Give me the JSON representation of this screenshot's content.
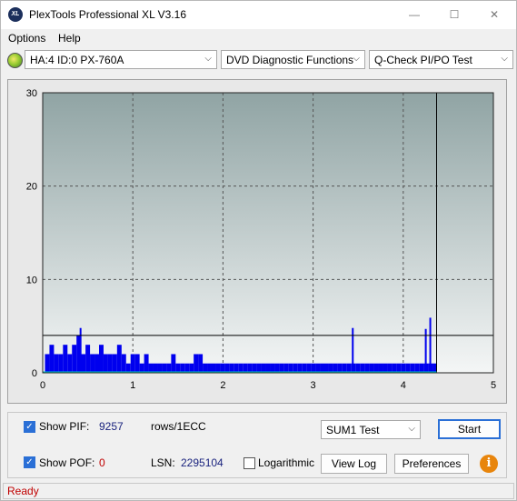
{
  "window": {
    "title": "PlexTools Professional XL V3.16",
    "app_icon_text": "XL",
    "minimize_glyph": "—",
    "maximize_glyph": "☐",
    "close_glyph": "✕"
  },
  "menu": {
    "options": "Options",
    "help": "Help"
  },
  "toolbar": {
    "drive": "HA:4 ID:0  PX-760A",
    "function": "DVD Diagnostic Functions",
    "test": "Q-Check PI/PO Test",
    "arrow_glyph": "⌵"
  },
  "chart_data": {
    "type": "bar",
    "title": "",
    "xlabel": "",
    "ylabel": "",
    "xlim": [
      0,
      5
    ],
    "ylim": [
      0,
      30
    ],
    "x_ticks": [
      0,
      1,
      2,
      3,
      4,
      5
    ],
    "y_ticks": [
      0,
      10,
      20,
      30
    ],
    "grid": true,
    "threshold_line": 4,
    "end_marker_x": 4.37,
    "colors": {
      "bars": "#0000ee",
      "plot_bg_top": "#90a4a4",
      "plot_bg_bottom": "#f4f6f6",
      "threshold": "#000000",
      "baseline_po": "#00c8c8"
    },
    "series": [
      {
        "x": [
          0.05,
          0.1,
          0.15,
          0.2,
          0.25,
          0.3,
          0.35,
          0.4,
          0.45,
          0.5,
          0.55,
          0.6,
          0.65,
          0.7,
          0.75,
          0.8,
          0.85,
          0.9,
          0.95,
          1.0,
          1.05,
          1.1,
          1.15,
          1.2,
          1.25,
          1.3,
          1.35,
          1.4,
          1.45,
          1.5,
          1.55,
          1.6,
          1.65,
          1.7,
          1.75,
          1.8,
          1.85,
          1.9,
          1.95,
          2.0,
          2.05,
          2.1,
          2.15,
          2.2,
          2.25,
          2.3,
          2.35,
          2.4,
          2.45,
          2.5,
          2.55,
          2.6,
          2.65,
          2.7,
          2.75,
          2.8,
          2.85,
          2.9,
          2.95,
          3.0,
          3.05,
          3.1,
          3.15,
          3.2,
          3.25,
          3.3,
          3.35,
          3.4,
          3.45,
          3.5,
          3.55,
          3.6,
          3.65,
          3.7,
          3.75,
          3.8,
          3.85,
          3.9,
          3.95,
          4.0,
          4.05,
          4.1,
          4.15,
          4.2,
          4.25,
          4.3,
          4.35
        ],
        "values": [
          2,
          3,
          2,
          2,
          3,
          2,
          3,
          4,
          2,
          3,
          2,
          2,
          3,
          2,
          2,
          2,
          3,
          2,
          1,
          2,
          2,
          1,
          2,
          1,
          1,
          1,
          1,
          1,
          2,
          1,
          1,
          1,
          1,
          2,
          2,
          1,
          1,
          1,
          1,
          1,
          1,
          1,
          1,
          1,
          1,
          1,
          1,
          1,
          1,
          1,
          1,
          1,
          1,
          1,
          1,
          1,
          1,
          1,
          1,
          1,
          1,
          1,
          1,
          1,
          1,
          1,
          1,
          1,
          1,
          1,
          1,
          1,
          1,
          1,
          1,
          1,
          1,
          1,
          1,
          1,
          1,
          1,
          1,
          1,
          1,
          1,
          1
        ]
      }
    ],
    "peaks": [
      {
        "x": 0.42,
        "y": 4.8
      },
      {
        "x": 3.44,
        "y": 4.8
      },
      {
        "x": 4.3,
        "y": 5.9
      },
      {
        "x": 4.25,
        "y": 4.7
      }
    ]
  },
  "bottom": {
    "show_pif_label": "Show PIF:",
    "pif_value": "9257",
    "pif_unit": "rows/1ECC",
    "show_pof_label": "Show POF:",
    "pof_value": "0",
    "lsn_label": "LSN:",
    "lsn_value": "2295104",
    "logarithmic_label": "Logarithmic",
    "sum_select": "SUM1 Test",
    "start_button": "Start",
    "view_log_button": "View Log",
    "preferences_button": "Preferences",
    "info_glyph": "i",
    "check_glyph": "✓"
  },
  "status": {
    "text": "Ready"
  }
}
